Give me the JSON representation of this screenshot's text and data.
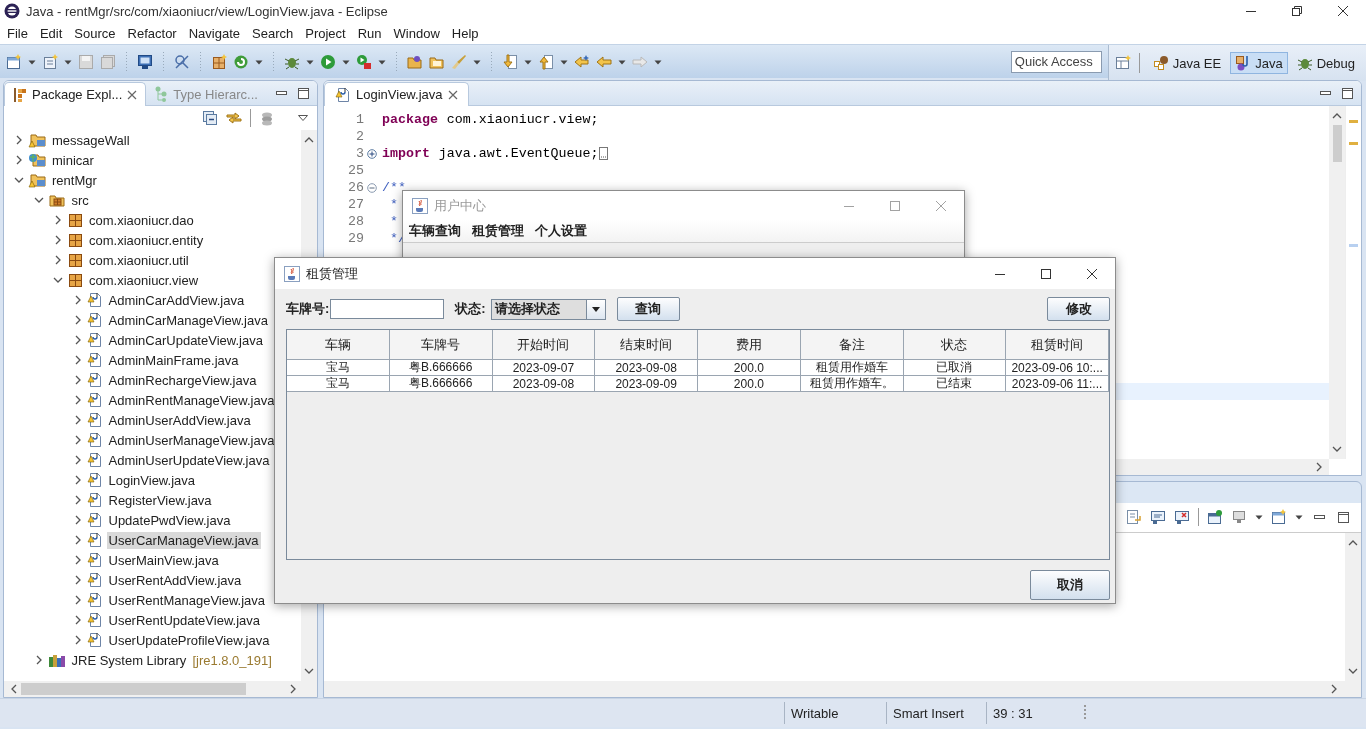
{
  "window": {
    "title": "Java - rentMgr/src/com/xiaoniucr/view/LoginView.java - Eclipse"
  },
  "menu": [
    "File",
    "Edit",
    "Source",
    "Refactor",
    "Navigate",
    "Search",
    "Project",
    "Run",
    "Window",
    "Help"
  ],
  "quick_access": {
    "placeholder": "Quick Access"
  },
  "perspectives": [
    {
      "label": "Java EE",
      "kind": "javaee",
      "selected": false
    },
    {
      "label": "Java",
      "kind": "java",
      "selected": true
    },
    {
      "label": "Debug",
      "kind": "debug",
      "selected": false
    }
  ],
  "explorer": {
    "tabs": [
      {
        "label": "Package Expl...",
        "selected": true
      },
      {
        "label": "Type Hierarc...",
        "selected": false
      }
    ],
    "tree": [
      {
        "label": "messageWall",
        "kind": "project",
        "expanded": false,
        "selected": false
      },
      {
        "label": "minicar",
        "kind": "web-project",
        "expanded": false,
        "selected": false
      },
      {
        "label": "rentMgr",
        "kind": "project",
        "expanded": true,
        "selected": false,
        "children": [
          {
            "label": "src",
            "kind": "source-folder",
            "expanded": true,
            "selected": false,
            "children": [
              {
                "label": "com.xiaoniucr.dao",
                "kind": "package",
                "expanded": false,
                "selected": false
              },
              {
                "label": "com.xiaoniucr.entity",
                "kind": "package",
                "expanded": false,
                "selected": false
              },
              {
                "label": "com.xiaoniucr.util",
                "kind": "package",
                "expanded": false,
                "selected": false
              },
              {
                "label": "com.xiaoniucr.view",
                "kind": "package",
                "expanded": true,
                "selected": false,
                "children": [
                  {
                    "label": "AdminCarAddView.java",
                    "kind": "java-file",
                    "expanded": false,
                    "selected": false
                  },
                  {
                    "label": "AdminCarManageView.java",
                    "kind": "java-file",
                    "expanded": false,
                    "selected": false
                  },
                  {
                    "label": "AdminCarUpdateView.java",
                    "kind": "java-file",
                    "expanded": false,
                    "selected": false
                  },
                  {
                    "label": "AdminMainFrame.java",
                    "kind": "java-file",
                    "expanded": false,
                    "selected": false
                  },
                  {
                    "label": "AdminRechargeView.java",
                    "kind": "java-file",
                    "expanded": false,
                    "selected": false
                  },
                  {
                    "label": "AdminRentManageView.java",
                    "kind": "java-file",
                    "expanded": false,
                    "selected": false
                  },
                  {
                    "label": "AdminUserAddView.java",
                    "kind": "java-file",
                    "expanded": false,
                    "selected": false
                  },
                  {
                    "label": "AdminUserManageView.java",
                    "kind": "java-file",
                    "expanded": false,
                    "selected": false
                  },
                  {
                    "label": "AdminUserUpdateView.java",
                    "kind": "java-file",
                    "expanded": false,
                    "selected": false
                  },
                  {
                    "label": "LoginView.java",
                    "kind": "java-file",
                    "expanded": false,
                    "selected": false
                  },
                  {
                    "label": "RegisterView.java",
                    "kind": "java-file",
                    "expanded": false,
                    "selected": false
                  },
                  {
                    "label": "UpdatePwdView.java",
                    "kind": "java-file",
                    "expanded": false,
                    "selected": false
                  },
                  {
                    "label": "UserCarManageView.java",
                    "kind": "java-file",
                    "expanded": false,
                    "selected": true
                  },
                  {
                    "label": "UserMainView.java",
                    "kind": "java-file",
                    "expanded": false,
                    "selected": false
                  },
                  {
                    "label": "UserRentAddView.java",
                    "kind": "java-file",
                    "expanded": false,
                    "selected": false
                  },
                  {
                    "label": "UserRentManageView.java",
                    "kind": "java-file",
                    "expanded": false,
                    "selected": false
                  },
                  {
                    "label": "UserRentUpdateView.java",
                    "kind": "java-file",
                    "expanded": false,
                    "selected": false
                  },
                  {
                    "label": "UserUpdateProfileView.java",
                    "kind": "java-file",
                    "expanded": false,
                    "selected": false
                  }
                ]
              }
            ]
          },
          {
            "label": "JRE System Library",
            "decoration": "[jre1.8.0_191]",
            "kind": "library",
            "expanded": false,
            "selected": false
          }
        ]
      }
    ]
  },
  "editor": {
    "tabs": [
      {
        "label": "LoginView.java",
        "selected": true
      }
    ],
    "lines": [
      {
        "number": "1",
        "tokens": [
          {
            "text": "package",
            "kind": "keyword"
          },
          {
            "text": " com.xiaoniucr.view;",
            "kind": "plain"
          }
        ]
      },
      {
        "number": "2"
      },
      {
        "number": "3",
        "folded": true,
        "tokens": [
          {
            "text": "import",
            "kind": "keyword"
          },
          {
            "text": " java.awt.EventQueue;",
            "kind": "plain"
          }
        ]
      },
      {
        "number": "25"
      },
      {
        "number": "26",
        "folded": false,
        "tokens": [
          {
            "text": "/**",
            "kind": "comment"
          }
        ]
      },
      {
        "number": "27",
        "tokens": [
          {
            "text": " *",
            "kind": "comment"
          }
        ]
      },
      {
        "number": "28",
        "tokens": [
          {
            "text": " *",
            "kind": "comment"
          }
        ]
      },
      {
        "number": "29",
        "tokens": [
          {
            "text": " */",
            "kind": "comment"
          }
        ]
      }
    ]
  },
  "status_bar": [
    "Writable",
    "Smart Insert",
    "39 : 31"
  ],
  "user_center_window": {
    "title": "用户中心",
    "active": false,
    "menu": [
      "车辆查询",
      "租赁管理",
      "个人设置"
    ]
  },
  "rental_window": {
    "title": "租赁管理",
    "active": true,
    "plate_label": "车牌号:",
    "status_label": "状态:",
    "status_combo": {
      "value": "请选择状态"
    },
    "buttons": {
      "query": "查询",
      "edit": "修改",
      "cancel": "取消"
    },
    "table": {
      "columns": [
        "车辆",
        "车牌号",
        "开始时间",
        "结束时间",
        "费用",
        "备注",
        "状态",
        "租赁时间"
      ],
      "rows": [
        [
          "宝马",
          "粤B.666666",
          "2023-09-07",
          "2023-09-08",
          "200.0",
          "租赁用作婚车",
          "已取消",
          "2023-09-06 10:..."
        ],
        [
          "宝马",
          "粤B.666666",
          "2023-09-08",
          "2023-09-09",
          "200.0",
          "租赁用作婚车。",
          "已结束",
          "2023-09-06 11:..."
        ]
      ]
    }
  }
}
